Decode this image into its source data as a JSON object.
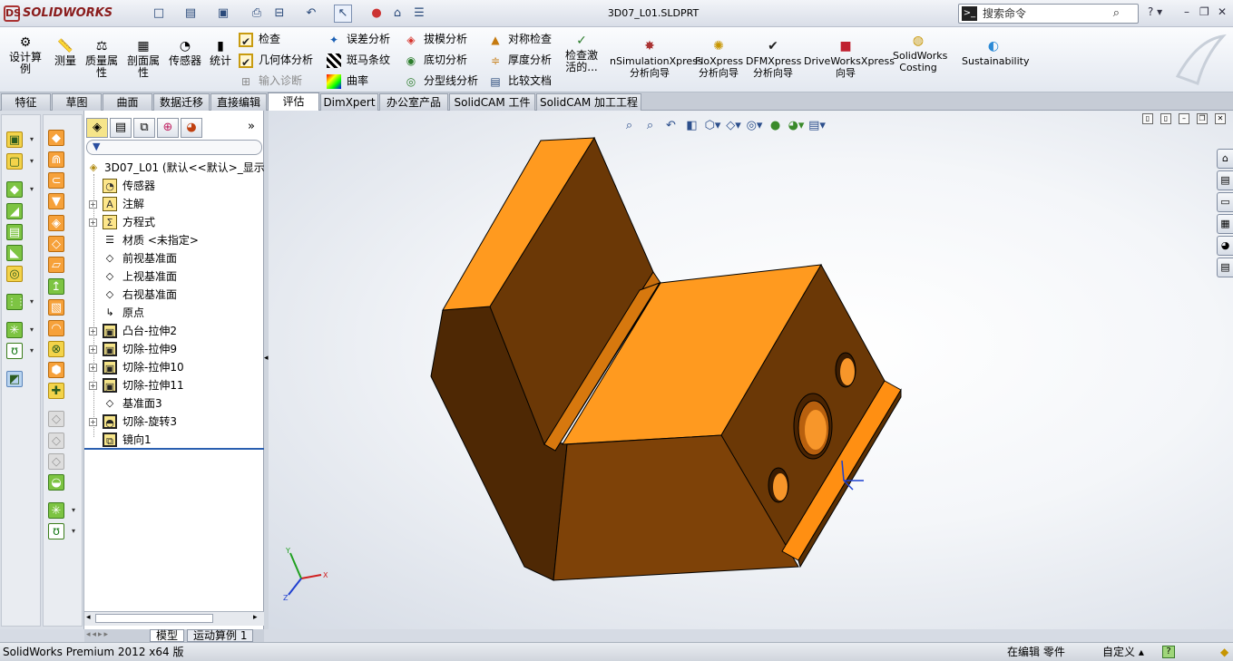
{
  "app": {
    "logo_text": "SOLIDWORKS",
    "logo_mark": "DS",
    "doc_title": "3D07_L01.SLDPRT"
  },
  "search": {
    "placeholder": "搜索命令",
    "icon": "command-prompt-icon"
  },
  "ribbon": {
    "design_study": "设计算例",
    "measure": "测量",
    "mass_props": "质量属性",
    "section_props": "剖面属性",
    "sensors": "传感器",
    "statistics": "统计",
    "check": "检查",
    "geometry_analysis": "几何体分析",
    "import_diagnostics": "输入诊断",
    "deviation_analysis": "误差分析",
    "zebra_stripes": "斑马条纹",
    "curvature": "曲率",
    "draft_analysis": "拔模分析",
    "undercut_analysis": "底切分析",
    "parting_line_analysis": "分型线分析",
    "symmetry_check": "对称检查",
    "thickness_analysis": "厚度分析",
    "compare_documents": "比较文档",
    "check_active": "检查激活的...",
    "simulation": "nSimulationXpress 分析向导",
    "floxpress": "FloXpress 分析向导",
    "dfmxpress": "DFMXpress 分析向导",
    "driveworks": "DriveWorksXpress 向导",
    "costing": "SolidWorks Costing",
    "sustainability": "Sustainability"
  },
  "tabs": [
    "特征",
    "草图",
    "曲面",
    "数据迁移",
    "直接编辑",
    "评估",
    "DimXpert",
    "办公室产品",
    "SolidCAM 工件",
    "SolidCAM 加工工程"
  ],
  "active_tab": "评估",
  "tree": {
    "root": "3D07_L01 (默认<<默认>_显示",
    "items": [
      {
        "label": "传感器",
        "icon": "sensor-icon",
        "expandable": false
      },
      {
        "label": "注解",
        "icon": "annotation-icon",
        "expandable": true
      },
      {
        "label": "方程式",
        "icon": "equation-icon",
        "expandable": true
      },
      {
        "label": "材质 <未指定>",
        "icon": "material-icon",
        "expandable": false
      },
      {
        "label": "前视基准面",
        "icon": "plane-icon",
        "expandable": false
      },
      {
        "label": "上视基准面",
        "icon": "plane-icon",
        "expandable": false
      },
      {
        "label": "右视基准面",
        "icon": "plane-icon",
        "expandable": false
      },
      {
        "label": "原点",
        "icon": "origin-icon",
        "expandable": false
      },
      {
        "label": "凸台-拉伸2",
        "icon": "boss-extrude-icon",
        "expandable": true
      },
      {
        "label": "切除-拉伸9",
        "icon": "cut-extrude-icon",
        "expandable": true
      },
      {
        "label": "切除-拉伸10",
        "icon": "cut-extrude-icon",
        "expandable": true
      },
      {
        "label": "切除-拉伸11",
        "icon": "cut-extrude-icon",
        "expandable": true
      },
      {
        "label": "基准面3",
        "icon": "plane-icon",
        "expandable": false
      },
      {
        "label": "切除-旋转3",
        "icon": "cut-revolve-icon",
        "expandable": true
      },
      {
        "label": "镜向1",
        "icon": "mirror-icon",
        "expandable": false
      }
    ]
  },
  "bottom_tabs": [
    "模型",
    "运动算例 1"
  ],
  "status": {
    "version": "SolidWorks Premium 2012 x64 版",
    "mode": "在编辑 零件",
    "units": "自定义"
  },
  "colors": {
    "part_top": "#ff9a1f",
    "part_side": "#6b3806",
    "part_dark": "#4a2503",
    "part_front": "#8a4a0a"
  }
}
